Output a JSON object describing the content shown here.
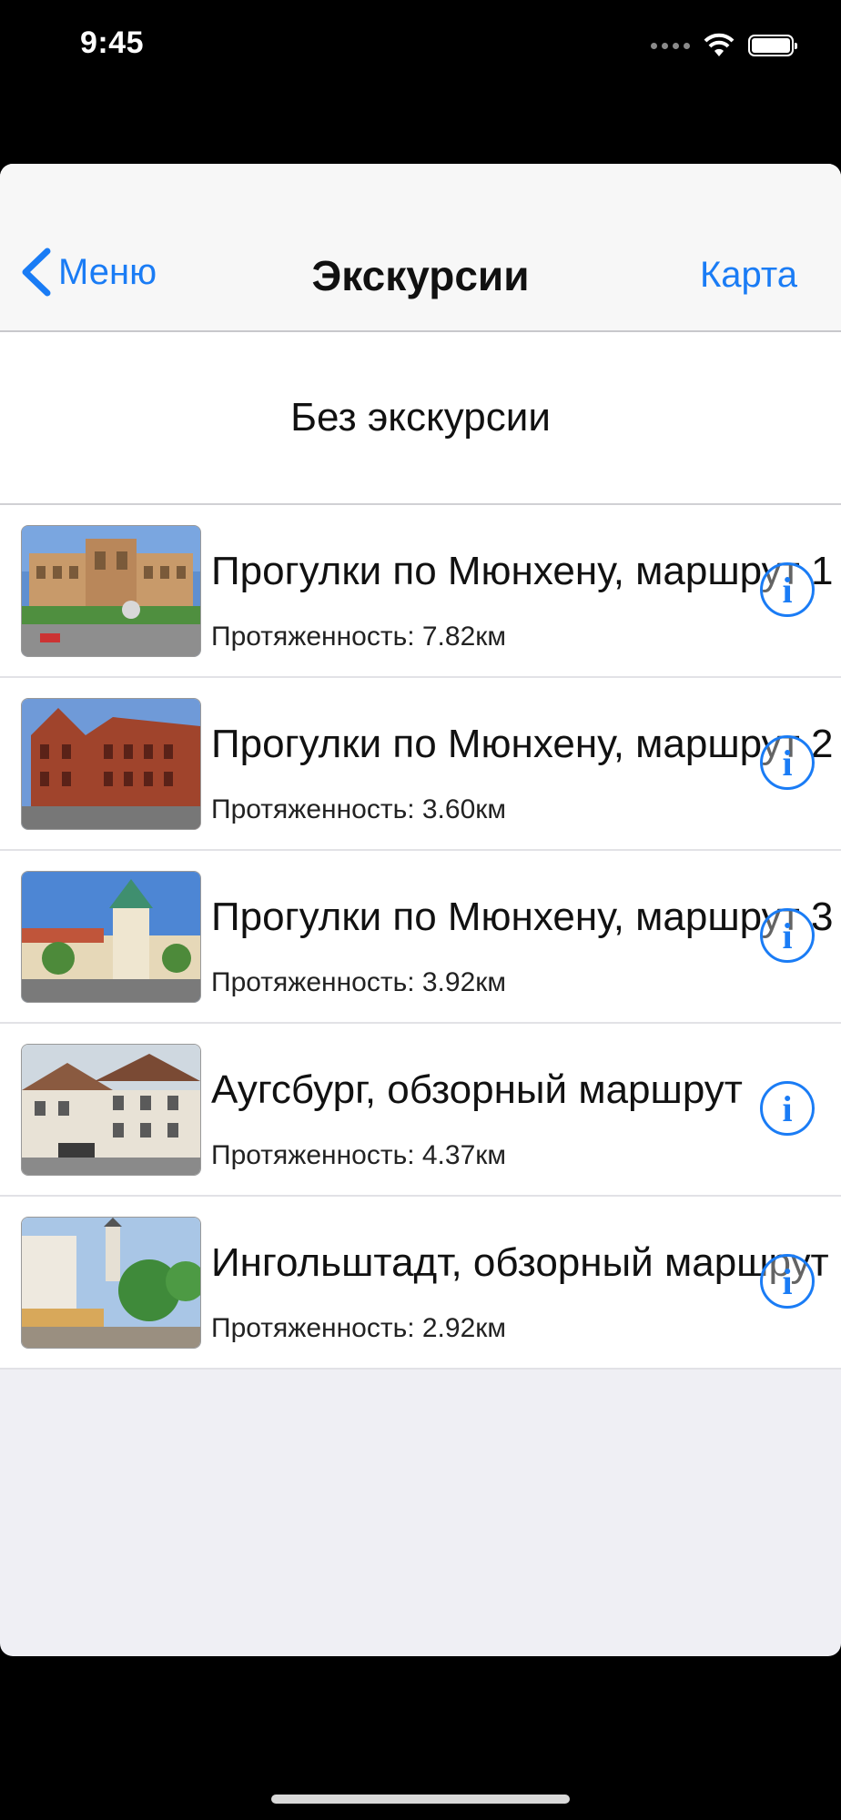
{
  "status_bar": {
    "time": "9:45"
  },
  "nav": {
    "back_label": "Меню",
    "title": "Экскурсии",
    "right_label": "Карта"
  },
  "no_tour": {
    "label": "Без экскурсии"
  },
  "tours": [
    {
      "title": "Прогулки по Мюнхену, маршрут 1",
      "length": "Протяженность: 7.82км",
      "thumb": "munich-parliament"
    },
    {
      "title": "Прогулки по Мюнхену, маршрут 2",
      "length": "Протяженность: 3.60км",
      "thumb": "munich-brick-building"
    },
    {
      "title": "Прогулки по Мюнхену, маршрут 3",
      "length": "Протяженность: 3.92км",
      "thumb": "munich-tower"
    },
    {
      "title": "Аугсбург, обзорный маршрут",
      "length": "Протяженность: 4.37км",
      "thumb": "augsburg-old-house"
    },
    {
      "title": "Ингольштадт, обзорный маршрут",
      "length": "Протяженность: 2.92км",
      "thumb": "ingolstadt-street"
    }
  ],
  "colors": {
    "accent": "#1a7cf5",
    "background": "#efeff4"
  }
}
